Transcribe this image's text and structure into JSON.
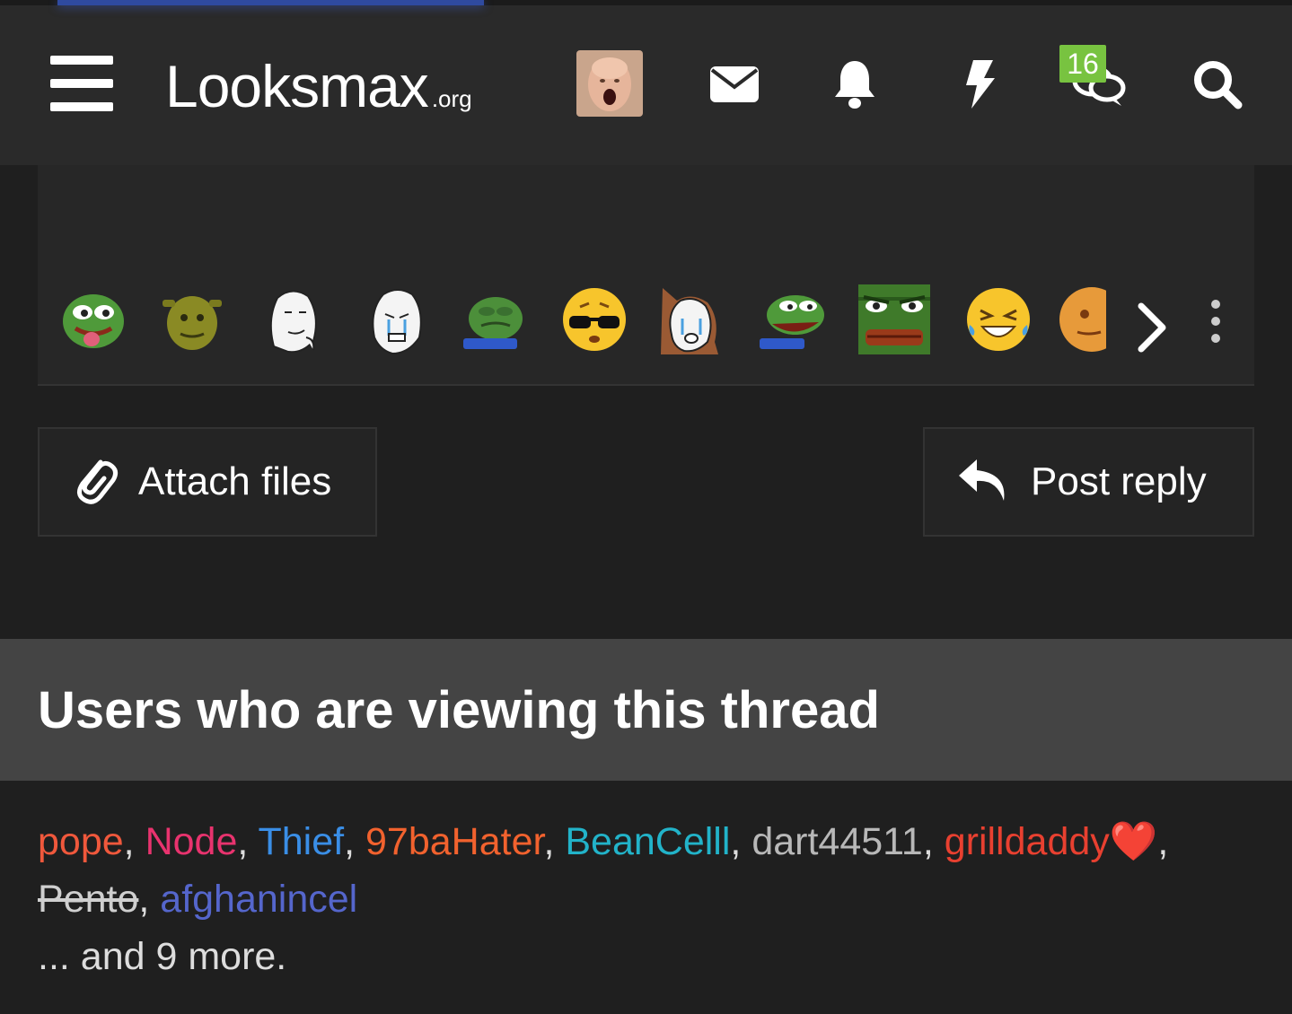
{
  "header": {
    "logo_text": "Looksmax",
    "logo_tld": ".org",
    "notification_badge": "16",
    "page_load_progress": 0.33
  },
  "icons": {
    "menu": "hamburger-icon",
    "avatar": "user-avatar",
    "inbox": "envelope-icon",
    "alerts": "bell-icon",
    "whats_new": "bolt-icon",
    "chat": "chat-bubbles-icon",
    "search": "search-icon"
  },
  "emoji_bar": {
    "emojis": [
      "pepe-tongue",
      "shrek",
      "wojak-smirk",
      "wojak-cry",
      "pepe-sad",
      "sunglasses-blush",
      "wojak-hood-cry",
      "pepe-laugh",
      "pepe-mad",
      "laugh-cry",
      "orange-face"
    ],
    "next_icon": "chevron-right-icon",
    "more_icon": "vertical-dots-icon"
  },
  "actions": {
    "attach_label": "Attach files",
    "reply_label": "Post reply"
  },
  "viewers": {
    "title": "Users who are viewing this thread",
    "users": [
      {
        "name": "pope",
        "color": "#f0583c"
      },
      {
        "name": "Node",
        "color": "#e8336e"
      },
      {
        "name": "Thief",
        "color": "#3a8ee6"
      },
      {
        "name": "97baHater",
        "color": "#f2622e"
      },
      {
        "name": "BeanCelll",
        "color": "#22b3c9"
      },
      {
        "name": "dart44511",
        "color": "#b8b8b8"
      },
      {
        "name": "grilldaddy",
        "color": "#e84030",
        "heart": "❤️"
      },
      {
        "name": "Pento",
        "color": "#cfcfcf",
        "strike": true
      },
      {
        "name": "afghanincel",
        "color": "#5566cc"
      }
    ],
    "more_text": "... and 9 more."
  }
}
